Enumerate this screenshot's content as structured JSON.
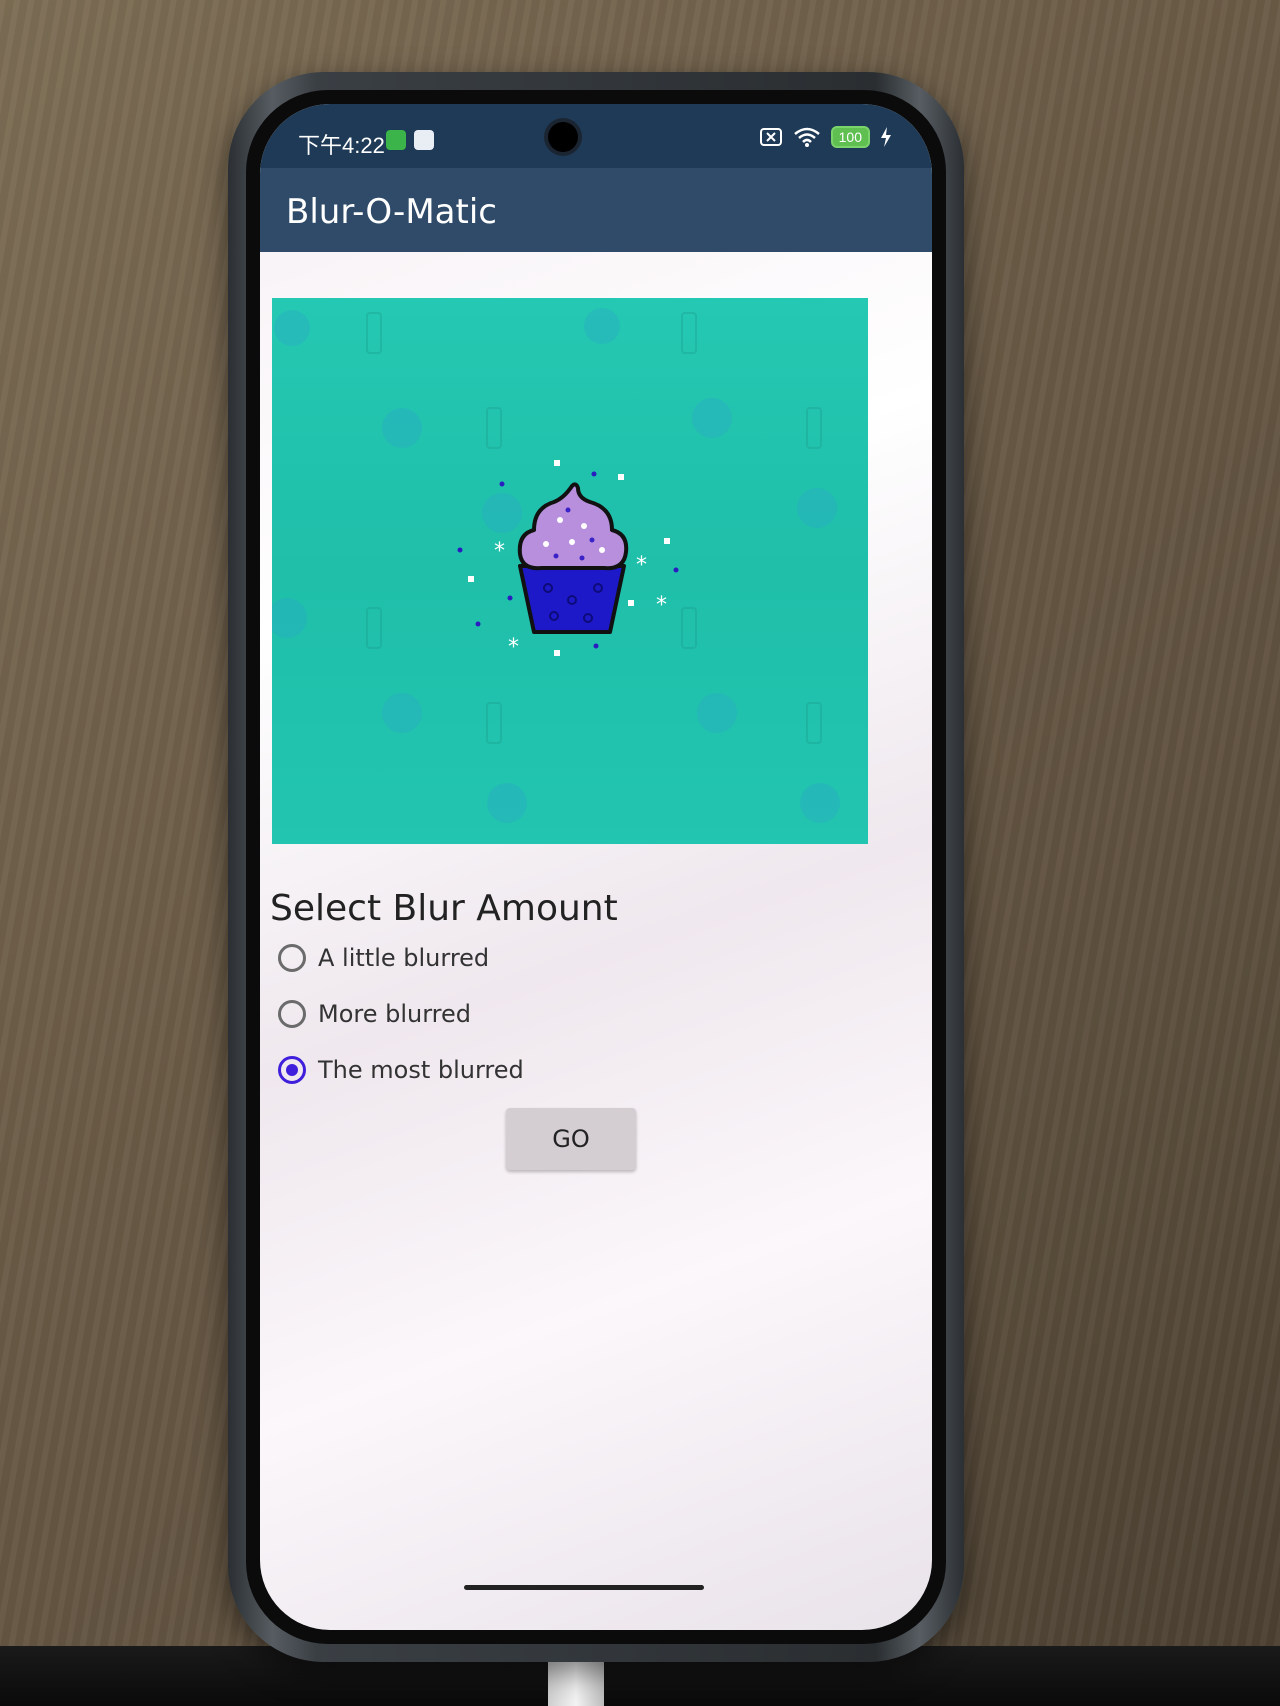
{
  "status_bar": {
    "time": "下午4:22",
    "battery": "100"
  },
  "app": {
    "title": "Blur-O-Matic"
  },
  "image": {
    "subject": "cupcake",
    "background_color": "#22c4af",
    "frosting_color": "#b78fdc",
    "cup_color": "#1d19c9"
  },
  "blur_selector": {
    "heading": "Select Blur Amount",
    "options": [
      {
        "label": "A little blurred",
        "selected": false
      },
      {
        "label": "More blurred",
        "selected": false
      },
      {
        "label": "The most blurred",
        "selected": true
      }
    ]
  },
  "actions": {
    "go_label": "GO"
  },
  "colors": {
    "status_bar": "#1e3a56",
    "app_bar": "#2f4b69",
    "accent": "#3f1fdc"
  }
}
